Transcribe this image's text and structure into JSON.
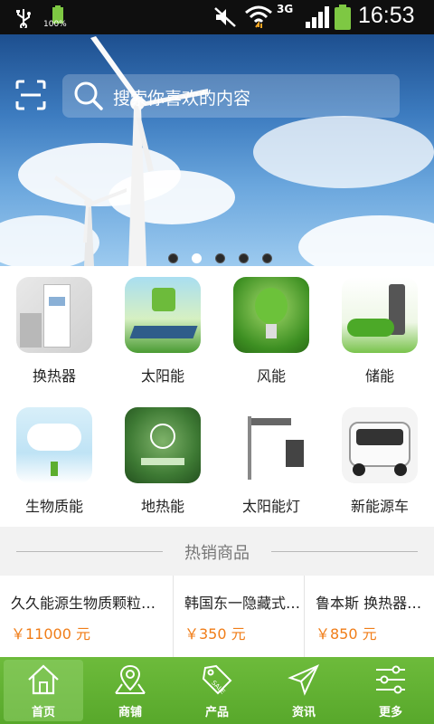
{
  "status_bar": {
    "battery_small_pct": "100%",
    "network": "3G",
    "time": "16:53"
  },
  "search": {
    "placeholder": "搜索你喜欢的内容"
  },
  "banner": {
    "slide_count": 5,
    "active_slide": 2
  },
  "categories": [
    {
      "label": "换热器",
      "icon": "heat-exchanger-image"
    },
    {
      "label": "太阳能",
      "icon": "solar-eco-image"
    },
    {
      "label": "风能",
      "icon": "green-bulb-image"
    },
    {
      "label": "储能",
      "icon": "ev-charging-image"
    },
    {
      "label": "生物质能",
      "icon": "eco-cloud-image"
    },
    {
      "label": "地热能",
      "icon": "go-green-image"
    },
    {
      "label": "太阳能灯",
      "icon": "street-lamp-image"
    },
    {
      "label": "新能源车",
      "icon": "electric-car-image"
    }
  ],
  "hot": {
    "title": "热销商品"
  },
  "products": [
    {
      "name": "久久能源生物质颗粒…",
      "price": "￥11000 元"
    },
    {
      "name": "韩国东一隐藏式…",
      "price": "￥350 元"
    },
    {
      "name": "鲁本斯 换热器…",
      "price": "￥850 元"
    }
  ],
  "tabs": [
    {
      "label": "首页",
      "icon": "home-icon",
      "active": true
    },
    {
      "label": "商铺",
      "icon": "shop-map-icon",
      "active": false
    },
    {
      "label": "产品",
      "icon": "sale-tag-icon",
      "active": false
    },
    {
      "label": "资讯",
      "icon": "paper-plane-icon",
      "active": false
    },
    {
      "label": "更多",
      "icon": "sliders-icon",
      "active": false
    }
  ],
  "colors": {
    "accent": "#5aac2e",
    "price": "#f07d18",
    "statusbar": "#0f0f0f"
  }
}
